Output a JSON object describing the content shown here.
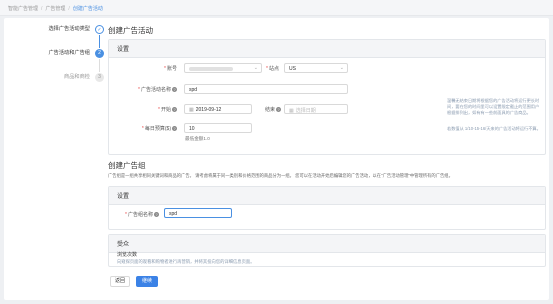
{
  "breadcrumb": {
    "items": [
      "智能广告管理",
      "广告管理",
      "创建广告活动"
    ]
  },
  "steps": [
    {
      "label": "选择广告活动类型",
      "marker": "✓"
    },
    {
      "label": "广告活动和广告组",
      "marker": "2"
    },
    {
      "label": "商品和商检",
      "marker": "3"
    }
  ],
  "campaign": {
    "title": "创建广告活动",
    "settings_title": "设置",
    "account_label": "账号",
    "site_label": "站点",
    "site_value": "US",
    "name_label": "广告活动名称",
    "name_value": "spd",
    "start_label": "开始",
    "start_value": "2019-09-12",
    "end_label": "结束",
    "end_placeholder": "选择日期",
    "budget_label": "每日预算($)",
    "budget_value": "10",
    "budget_hint": "最低金额1.0",
    "note_1": "温馨无结束日期将根据您的广告活动将运行更长时间，要在您的时间里可以设置限定截止的范围用户根据排列出，如有有一些前面具的广告商品。",
    "note_2": "若数值从 1/10-15-16/天来的广告活动将运行不算。"
  },
  "adgroup": {
    "title": "创建广告组",
    "description": "广告组是一组共享相同关键词和商品的广告。 请考虑将属于同一类别和价格范围的商品分为一组。 您可以在活动开始后编辑您的广告活动，以在\"广告活动管理\"中管理所有的广告组。",
    "settings_title": "设置",
    "name_label": "广告组名称",
    "name_value": "spd"
  },
  "audience": {
    "title": "受众",
    "subtitle": "浏览次数",
    "description": "向窥探页面的观看和购物者进行再营销，并将其投向您的详细信息页面。"
  },
  "buttons": {
    "back": "返回",
    "next": "继续"
  },
  "colors": {
    "accent": "#3b82e6",
    "required": "#e84a4a",
    "note": "#8a9bb0"
  },
  "icons": {
    "date": "calendar-icon",
    "select": "chevron-down-icon",
    "help": "question-circle-icon"
  }
}
